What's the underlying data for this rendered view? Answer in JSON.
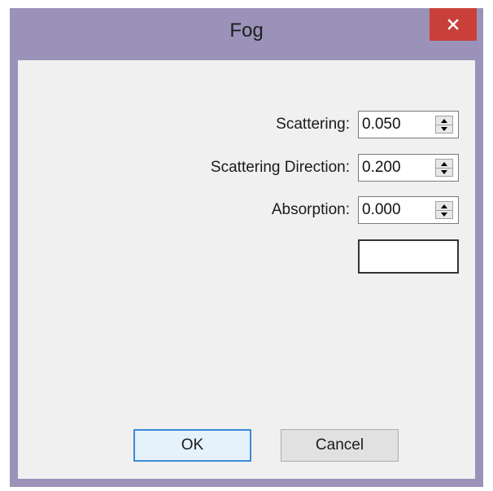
{
  "window": {
    "title": "Fog"
  },
  "fields": [
    {
      "label": "Scattering:",
      "value": "0.050"
    },
    {
      "label": "Scattering Direction:",
      "value": "0.200"
    },
    {
      "label": "Absorption:",
      "value": "0.000"
    }
  ],
  "color_swatch": {
    "color": "#ffffff"
  },
  "buttons": {
    "ok_label": "OK",
    "cancel_label": "Cancel"
  },
  "colors": {
    "title_bar": "#9a92b8",
    "close_button": "#c9403b",
    "dialog_background": "#f0f0f0",
    "default_button_border": "#3c8ad8"
  },
  "icons": {
    "close": "close-icon",
    "spin_up": "arrow-up-icon",
    "spin_down": "arrow-down-icon"
  }
}
